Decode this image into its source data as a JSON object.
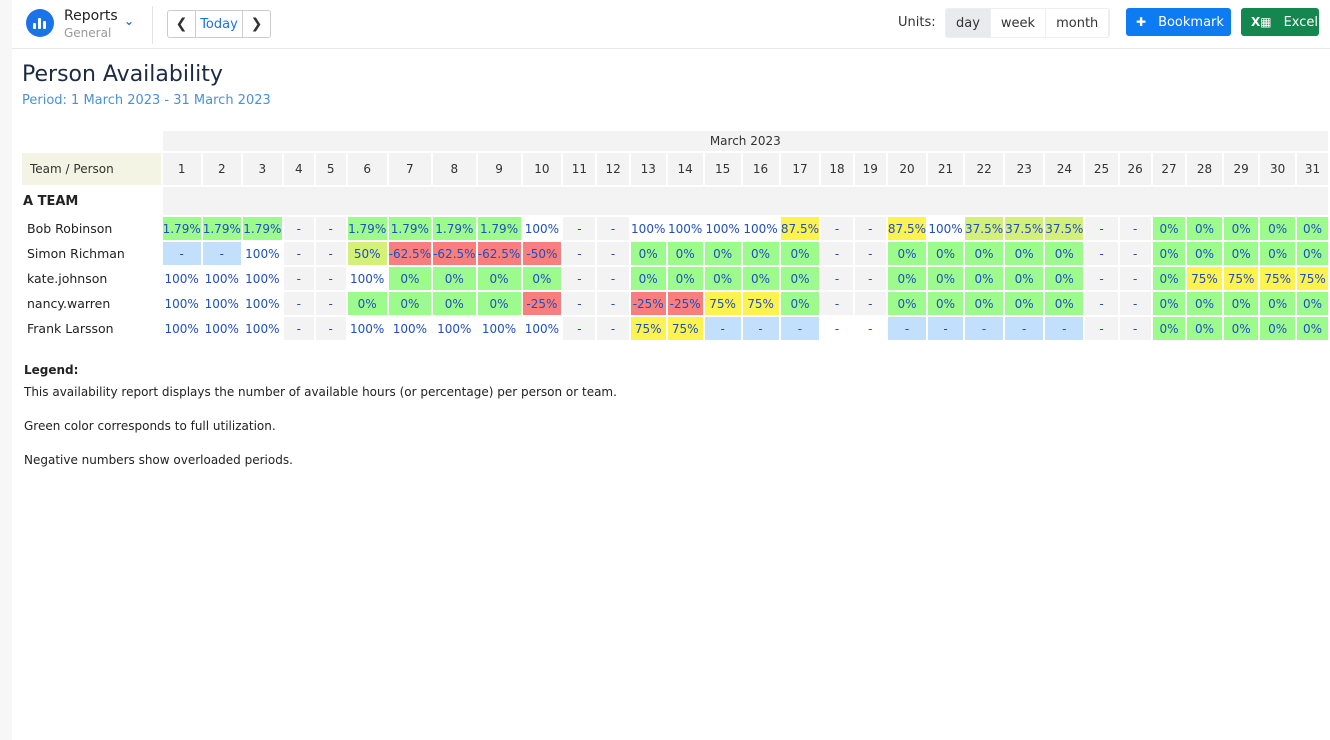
{
  "header": {
    "app_title": "Reports",
    "app_subtitle": "General",
    "today_label": "Today",
    "units_label": "Units:",
    "units": [
      {
        "label": "day",
        "active": true
      },
      {
        "label": "week",
        "active": false
      },
      {
        "label": "month",
        "active": false
      }
    ],
    "bookmark_label": "Bookmark",
    "excel_label": "Excel",
    "colors": {
      "brand": "#1a73e8",
      "bookmark": "#0d7bf2",
      "excel": "#14874f"
    }
  },
  "report": {
    "title": "Person Availability",
    "period": "Period: 1 March 2023 - 31 March 2023",
    "month_label": "March 2023",
    "corner_label": "Team / Person",
    "days": [
      "1",
      "2",
      "3",
      "4",
      "5",
      "6",
      "7",
      "8",
      "9",
      "10",
      "11",
      "12",
      "13",
      "14",
      "15",
      "16",
      "17",
      "18",
      "19",
      "20",
      "21",
      "22",
      "23",
      "24",
      "25",
      "26",
      "27",
      "28",
      "29",
      "30",
      "31"
    ],
    "team": "A TEAM",
    "cell_colors": {
      "green": "#9dfb8d",
      "yellow": "#fdf34f",
      "lime": "#d4f07a",
      "red": "#f97e7e",
      "blue": "#c2e0fb",
      "weekend": "#f3f3f3",
      "white": "#ffffff"
    },
    "rows": [
      {
        "name": "Bob Robinson",
        "cells": [
          [
            "1.79%",
            "green"
          ],
          [
            "1.79%",
            "green"
          ],
          [
            "1.79%",
            "green"
          ],
          [
            "-",
            "weekend"
          ],
          [
            "-",
            "weekend"
          ],
          [
            "1.79%",
            "green"
          ],
          [
            "1.79%",
            "green"
          ],
          [
            "1.79%",
            "green"
          ],
          [
            "1.79%",
            "green"
          ],
          [
            "100%",
            "white"
          ],
          [
            "-",
            "weekend"
          ],
          [
            "-",
            "weekend"
          ],
          [
            "100%",
            "white"
          ],
          [
            "100%",
            "white"
          ],
          [
            "100%",
            "white"
          ],
          [
            "100%",
            "white"
          ],
          [
            "87.5%",
            "yellow"
          ],
          [
            "-",
            "weekend"
          ],
          [
            "-",
            "weekend"
          ],
          [
            "87.5%",
            "yellow"
          ],
          [
            "100%",
            "white"
          ],
          [
            "37.5%",
            "lime"
          ],
          [
            "37.5%",
            "lime"
          ],
          [
            "37.5%",
            "lime"
          ],
          [
            "-",
            "weekend"
          ],
          [
            "-",
            "weekend"
          ],
          [
            "0%",
            "green"
          ],
          [
            "0%",
            "green"
          ],
          [
            "0%",
            "green"
          ],
          [
            "0%",
            "green"
          ],
          [
            "0%",
            "green"
          ]
        ]
      },
      {
        "name": "Simon Richman",
        "cells": [
          [
            "-",
            "blue"
          ],
          [
            "-",
            "blue"
          ],
          [
            "100%",
            "white"
          ],
          [
            "-",
            "weekend"
          ],
          [
            "-",
            "weekend"
          ],
          [
            "50%",
            "lime"
          ],
          [
            "-62.5%",
            "red"
          ],
          [
            "-62.5%",
            "red"
          ],
          [
            "-62.5%",
            "red"
          ],
          [
            "-50%",
            "red"
          ],
          [
            "-",
            "weekend"
          ],
          [
            "-",
            "weekend"
          ],
          [
            "0%",
            "green"
          ],
          [
            "0%",
            "green"
          ],
          [
            "0%",
            "green"
          ],
          [
            "0%",
            "green"
          ],
          [
            "0%",
            "green"
          ],
          [
            "-",
            "weekend"
          ],
          [
            "-",
            "weekend"
          ],
          [
            "0%",
            "green"
          ],
          [
            "0%",
            "green"
          ],
          [
            "0%",
            "green"
          ],
          [
            "0%",
            "green"
          ],
          [
            "0%",
            "green"
          ],
          [
            "-",
            "weekend"
          ],
          [
            "-",
            "weekend"
          ],
          [
            "0%",
            "green"
          ],
          [
            "0%",
            "green"
          ],
          [
            "0%",
            "green"
          ],
          [
            "0%",
            "green"
          ],
          [
            "0%",
            "green"
          ]
        ]
      },
      {
        "name": "kate.johnson",
        "cells": [
          [
            "100%",
            "white"
          ],
          [
            "100%",
            "white"
          ],
          [
            "100%",
            "white"
          ],
          [
            "-",
            "weekend"
          ],
          [
            "-",
            "weekend"
          ],
          [
            "100%",
            "white"
          ],
          [
            "0%",
            "green"
          ],
          [
            "0%",
            "green"
          ],
          [
            "0%",
            "green"
          ],
          [
            "0%",
            "green"
          ],
          [
            "-",
            "weekend"
          ],
          [
            "-",
            "weekend"
          ],
          [
            "0%",
            "green"
          ],
          [
            "0%",
            "green"
          ],
          [
            "0%",
            "green"
          ],
          [
            "0%",
            "green"
          ],
          [
            "0%",
            "green"
          ],
          [
            "-",
            "weekend"
          ],
          [
            "-",
            "weekend"
          ],
          [
            "0%",
            "green"
          ],
          [
            "0%",
            "green"
          ],
          [
            "0%",
            "green"
          ],
          [
            "0%",
            "green"
          ],
          [
            "0%",
            "green"
          ],
          [
            "-",
            "weekend"
          ],
          [
            "-",
            "weekend"
          ],
          [
            "0%",
            "green"
          ],
          [
            "75%",
            "yellow"
          ],
          [
            "75%",
            "yellow"
          ],
          [
            "75%",
            "yellow"
          ],
          [
            "75%",
            "yellow"
          ]
        ]
      },
      {
        "name": "nancy.warren",
        "cells": [
          [
            "100%",
            "white"
          ],
          [
            "100%",
            "white"
          ],
          [
            "100%",
            "white"
          ],
          [
            "-",
            "weekend"
          ],
          [
            "-",
            "weekend"
          ],
          [
            "0%",
            "green"
          ],
          [
            "0%",
            "green"
          ],
          [
            "0%",
            "green"
          ],
          [
            "0%",
            "green"
          ],
          [
            "-25%",
            "red"
          ],
          [
            "-",
            "weekend"
          ],
          [
            "-",
            "weekend"
          ],
          [
            "-25%",
            "red"
          ],
          [
            "-25%",
            "red"
          ],
          [
            "75%",
            "yellow"
          ],
          [
            "75%",
            "yellow"
          ],
          [
            "0%",
            "green"
          ],
          [
            "-",
            "weekend"
          ],
          [
            "-",
            "weekend"
          ],
          [
            "0%",
            "green"
          ],
          [
            "0%",
            "green"
          ],
          [
            "0%",
            "green"
          ],
          [
            "0%",
            "green"
          ],
          [
            "0%",
            "green"
          ],
          [
            "-",
            "weekend"
          ],
          [
            "-",
            "weekend"
          ],
          [
            "0%",
            "green"
          ],
          [
            "0%",
            "green"
          ],
          [
            "0%",
            "green"
          ],
          [
            "0%",
            "green"
          ],
          [
            "0%",
            "green"
          ]
        ]
      },
      {
        "name": "Frank Larsson",
        "cells": [
          [
            "100%",
            "white"
          ],
          [
            "100%",
            "white"
          ],
          [
            "100%",
            "white"
          ],
          [
            "-",
            "weekend"
          ],
          [
            "-",
            "weekend"
          ],
          [
            "100%",
            "white"
          ],
          [
            "100%",
            "white"
          ],
          [
            "100%",
            "white"
          ],
          [
            "100%",
            "white"
          ],
          [
            "100%",
            "white"
          ],
          [
            "-",
            "weekend"
          ],
          [
            "-",
            "weekend"
          ],
          [
            "75%",
            "yellow"
          ],
          [
            "75%",
            "yellow"
          ],
          [
            "-",
            "blue"
          ],
          [
            "-",
            "blue"
          ],
          [
            "-",
            "blue"
          ],
          [
            "-",
            "white"
          ],
          [
            "-",
            "white"
          ],
          [
            "-",
            "blue"
          ],
          [
            "-",
            "blue"
          ],
          [
            "-",
            "blue"
          ],
          [
            "-",
            "blue"
          ],
          [
            "-",
            "blue"
          ],
          [
            "-",
            "weekend"
          ],
          [
            "-",
            "weekend"
          ],
          [
            "0%",
            "green"
          ],
          [
            "0%",
            "green"
          ],
          [
            "0%",
            "green"
          ],
          [
            "0%",
            "green"
          ],
          [
            "0%",
            "green"
          ]
        ]
      }
    ]
  },
  "legend": {
    "title": "Legend:",
    "lines": [
      "This availability report displays the number of available hours (or percentage) per person or team.",
      "Green color corresponds to full utilization.",
      "Negative numbers show overloaded periods."
    ]
  }
}
